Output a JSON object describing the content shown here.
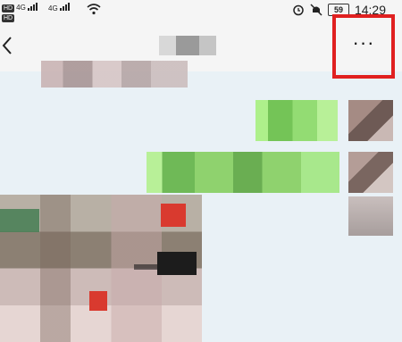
{
  "status_bar": {
    "sim1_label": "HD",
    "sim2_label": "HD",
    "network_1": "4G",
    "network_2": "4G",
    "battery_level": "59",
    "time": "14:29",
    "icons": [
      "signal-icon",
      "wifi-icon",
      "alarm-icon",
      "mute-icon",
      "battery-icon"
    ]
  },
  "nav": {
    "back_icon": "chevron-left-icon",
    "more_label": "···",
    "highlight_color": "#e02020"
  },
  "chat": {
    "bubble_color": "#9de77a",
    "background_color": "#e9f1f6"
  }
}
